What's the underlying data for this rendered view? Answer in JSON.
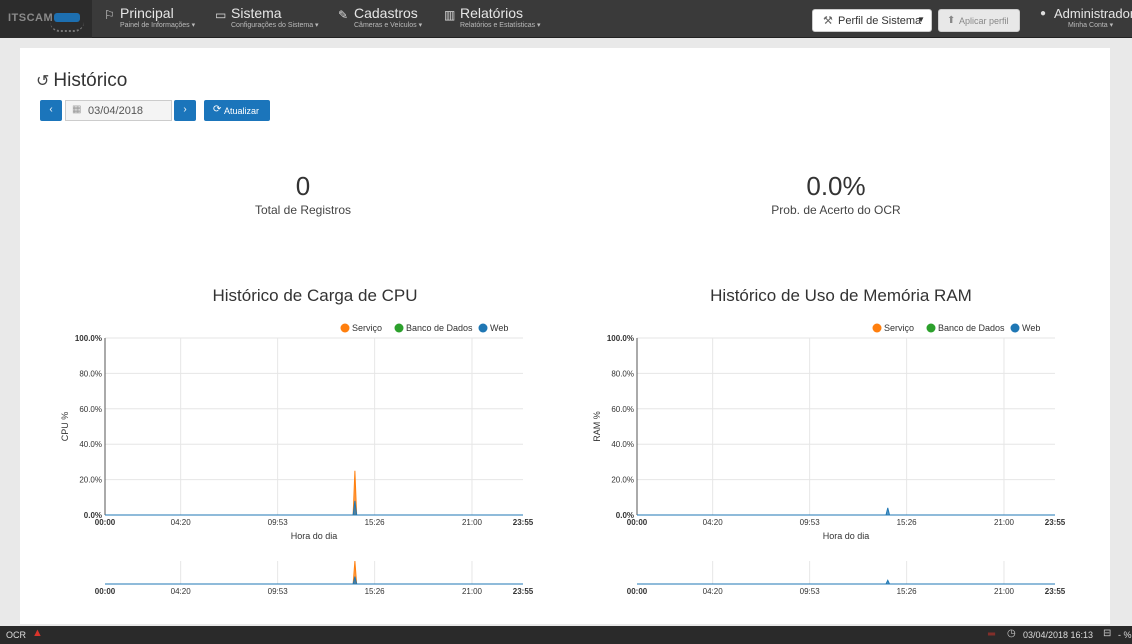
{
  "navbar": {
    "logo_text": "ITSCAM",
    "items": [
      {
        "icon": "flag-icon",
        "title": "Principal",
        "sub": "Painel de Informações ▾"
      },
      {
        "icon": "monitor-icon",
        "title": "Sistema",
        "sub": "Configurações do Sistema ▾"
      },
      {
        "icon": "edit-icon",
        "title": "Cadastros",
        "sub": "Câmeras e Veículos ▾"
      },
      {
        "icon": "bar-chart-icon",
        "title": "Relatórios",
        "sub": "Relatórios e Estatísticas ▾"
      }
    ],
    "perfil_label": "Perfil de Sistema",
    "aplicar_label": "Aplicar perfil",
    "user_name": "Administrador",
    "user_sub": "Minha Conta ▾"
  },
  "page": {
    "title": "Histórico",
    "date_value": "03/04/2018",
    "refresh_label": "Atualizar",
    "prev_glyph": "‹",
    "next_glyph": "›"
  },
  "stats": {
    "total_value": "0",
    "total_label": "Total de Registros",
    "ocr_value": "0.0%",
    "ocr_label": "Prob. de Acerto do OCR"
  },
  "charts": {
    "cpu_title": "Histórico de Carga de CPU",
    "ram_title": "Histórico de Uso de Memória RAM"
  },
  "chart_data": [
    {
      "type": "area",
      "title": "Histórico de Carga de CPU",
      "xlabel": "Hora do dia",
      "ylabel": "CPU %",
      "x_ticks": [
        "00:00",
        "04:20",
        "09:53",
        "15:26",
        "21:00",
        "23:55"
      ],
      "y_ticks": [
        "0.0%",
        "20.0%",
        "40.0%",
        "60.0%",
        "80.0%",
        "100.0%"
      ],
      "ylim": [
        0,
        100
      ],
      "legend": [
        "Serviço",
        "Banco de Dados",
        "Web"
      ],
      "legend_position": "top-right",
      "grid": true,
      "x_unit": "hours",
      "series": [
        {
          "name": "Serviço",
          "color": "#ff7f0e",
          "points": [
            [
              0,
              0
            ],
            [
              14.2,
              0
            ],
            [
              14.3,
              25
            ],
            [
              14.4,
              0
            ],
            [
              23.92,
              0
            ]
          ]
        },
        {
          "name": "Banco de Dados",
          "color": "#2ca02c",
          "points": [
            [
              0,
              0
            ],
            [
              23.92,
              0
            ]
          ]
        },
        {
          "name": "Web",
          "color": "#1f77b4",
          "points": [
            [
              0,
              0
            ],
            [
              14.2,
              0
            ],
            [
              14.3,
              8
            ],
            [
              14.4,
              0
            ],
            [
              23.92,
              0
            ]
          ]
        }
      ]
    },
    {
      "type": "area",
      "title": "Histórico de Uso de Memória RAM",
      "xlabel": "Hora do dia",
      "ylabel": "RAM %",
      "x_ticks": [
        "00:00",
        "04:20",
        "09:53",
        "15:26",
        "21:00",
        "23:55"
      ],
      "y_ticks": [
        "0.0%",
        "20.0%",
        "40.0%",
        "60.0%",
        "80.0%",
        "100.0%"
      ],
      "ylim": [
        0,
        100
      ],
      "legend": [
        "Serviço",
        "Banco de Dados",
        "Web"
      ],
      "legend_position": "top-right",
      "grid": true,
      "x_unit": "hours",
      "series": [
        {
          "name": "Serviço",
          "color": "#ff7f0e",
          "points": [
            [
              0,
              0
            ],
            [
              23.92,
              0
            ]
          ]
        },
        {
          "name": "Banco de Dados",
          "color": "#2ca02c",
          "points": [
            [
              0,
              0
            ],
            [
              23.92,
              0
            ]
          ]
        },
        {
          "name": "Web",
          "color": "#1f77b4",
          "points": [
            [
              0,
              0
            ],
            [
              14.25,
              0
            ],
            [
              14.35,
              4
            ],
            [
              14.45,
              0
            ],
            [
              23.92,
              0
            ]
          ]
        }
      ]
    }
  ],
  "statusbar": {
    "left_label": "OCR",
    "datetime": "03/04/2018 16:13",
    "disk": "- %"
  }
}
